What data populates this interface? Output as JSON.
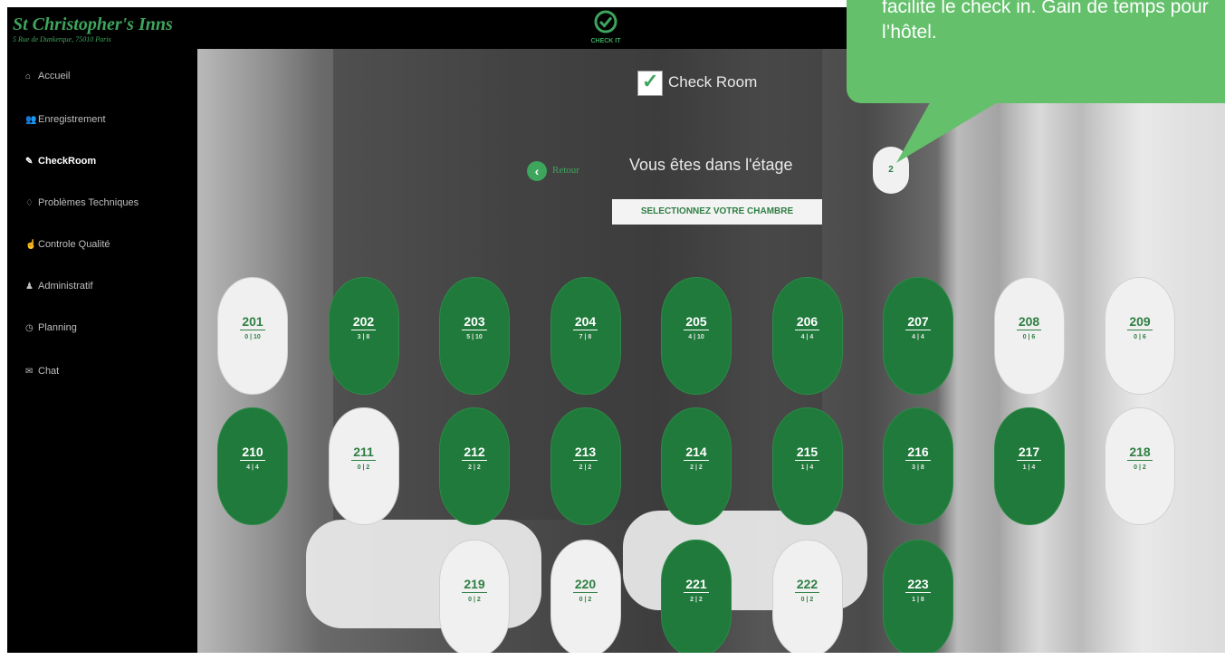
{
  "brand": {
    "name": "St Christopher's Inns",
    "address": "5 Rue de Dunkerque, 75010 Paris"
  },
  "logo": {
    "text": "CHECK IT"
  },
  "sidebar": {
    "items": [
      {
        "label": "Accueil",
        "icon": "home-icon",
        "glyph": "⌂"
      },
      {
        "label": "Enregistrement",
        "icon": "users-icon",
        "glyph": "👥"
      },
      {
        "label": "CheckRoom",
        "icon": "edit-icon",
        "glyph": "✎"
      },
      {
        "label": "Problèmes Techniques",
        "icon": "lightbulb-icon",
        "glyph": "♢"
      },
      {
        "label": "Controle Qualité",
        "icon": "thumbs-up-icon",
        "glyph": "☝"
      },
      {
        "label": "Administratif",
        "icon": "user-icon",
        "glyph": "♟"
      },
      {
        "label": "Planning",
        "icon": "clock-icon",
        "glyph": "◷"
      },
      {
        "label": "Chat",
        "icon": "chat-icon",
        "glyph": "✉"
      }
    ]
  },
  "main": {
    "title": "Check Room",
    "back_label": "Retour",
    "floor_label": "Vous êtes dans l'étage",
    "floor_number": "2",
    "select_label": "SELECTIONNEZ VOTRE CHAMBRE"
  },
  "rooms": [
    {
      "number": "201",
      "occupancy": "0 | 10",
      "status": "white"
    },
    {
      "number": "202",
      "occupancy": "3 | 8",
      "status": "green"
    },
    {
      "number": "203",
      "occupancy": "5 | 10",
      "status": "green"
    },
    {
      "number": "204",
      "occupancy": "7 | 8",
      "status": "green"
    },
    {
      "number": "205",
      "occupancy": "4 | 10",
      "status": "green"
    },
    {
      "number": "206",
      "occupancy": "4 | 4",
      "status": "green"
    },
    {
      "number": "207",
      "occupancy": "4 | 4",
      "status": "green"
    },
    {
      "number": "208",
      "occupancy": "0 | 6",
      "status": "white"
    },
    {
      "number": "209",
      "occupancy": "0 | 6",
      "status": "white"
    },
    {
      "number": "210",
      "occupancy": "4 | 4",
      "status": "green"
    },
    {
      "number": "211",
      "occupancy": "0 | 2",
      "status": "white"
    },
    {
      "number": "212",
      "occupancy": "2 | 2",
      "status": "green"
    },
    {
      "number": "213",
      "occupancy": "2 | 2",
      "status": "green"
    },
    {
      "number": "214",
      "occupancy": "2 | 2",
      "status": "green"
    },
    {
      "number": "215",
      "occupancy": "1 | 4",
      "status": "green"
    },
    {
      "number": "216",
      "occupancy": "3 | 8",
      "status": "green"
    },
    {
      "number": "217",
      "occupancy": "1 | 4",
      "status": "green"
    },
    {
      "number": "218",
      "occupancy": "0 | 2",
      "status": "white"
    },
    {
      "number": "219",
      "occupancy": "0 | 2",
      "status": "white"
    },
    {
      "number": "220",
      "occupancy": "0 | 2",
      "status": "white"
    },
    {
      "number": "221",
      "occupancy": "2 | 2",
      "status": "green"
    },
    {
      "number": "222",
      "occupancy": "0 | 2",
      "status": "white"
    },
    {
      "number": "223",
      "occupancy": "1 | 8",
      "status": "green"
    }
  ],
  "callout": {
    "text": "facilite le check in. Gain de temps pour l’hôtel."
  },
  "colors": {
    "accent": "#3ea55d",
    "room_occupied": "#1f7a3b",
    "room_free": "#f0f0f0",
    "callout": "#64c06b"
  }
}
